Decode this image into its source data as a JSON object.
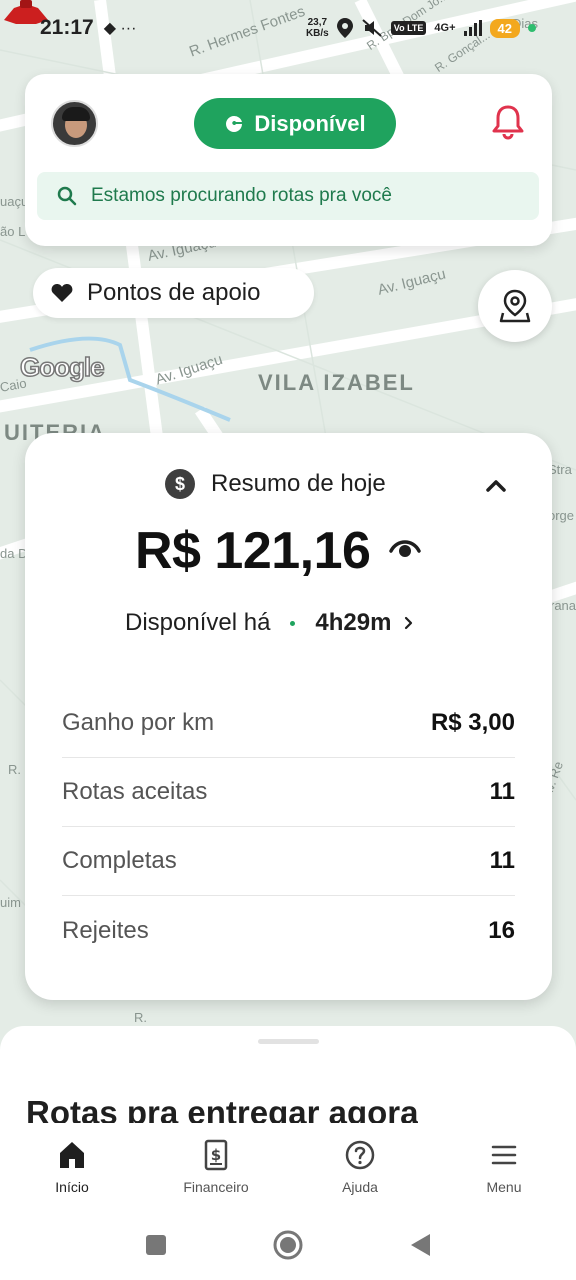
{
  "status_bar": {
    "time": "21:17",
    "left_icons": "◆ ···",
    "speed_top": "23,7",
    "speed_bottom": "KB/s",
    "network": "4G+",
    "volte": "Vo LTE",
    "battery": "42"
  },
  "map": {
    "labels": [
      "R. Hermes Fontes",
      "R. Bpo. Dom Jo...",
      "R. Gonçal...",
      "Dias",
      "Av. Iguaçu",
      "Av. Iguaçu",
      "Av. Iguaçu",
      "VILA IZABEL",
      "UITERIA",
      "Caio",
      "uaçu",
      "ão L",
      "Stra",
      "orge",
      "da D",
      "rana",
      "Av. Re",
      "R.",
      "uim",
      "R."
    ],
    "attribution": "Google"
  },
  "top_card": {
    "status_label": "Disponível",
    "search_message": "Estamos procurando rotas pra você"
  },
  "apoio": {
    "label": "Pontos de apoio"
  },
  "summary": {
    "title": "Resumo de hoje",
    "amount": "R$ 121,16",
    "available_label": "Disponível há",
    "available_time": "4h29m",
    "stats": [
      {
        "label": "Ganho por km",
        "value": "R$ 3,00"
      },
      {
        "label": "Rotas aceitas",
        "value": "11"
      },
      {
        "label": "Completas",
        "value": "11"
      },
      {
        "label": "Rejeites",
        "value": "16"
      }
    ]
  },
  "sheet": {
    "title": "Rotas pra entregar agora"
  },
  "bottom_nav": {
    "items": [
      {
        "label": "Início",
        "icon": "home-icon"
      },
      {
        "label": "Financeiro",
        "icon": "receipt-icon"
      },
      {
        "label": "Ajuda",
        "icon": "help-icon"
      },
      {
        "label": "Menu",
        "icon": "menu-icon"
      }
    ]
  },
  "colors": {
    "accent_green": "#1fa35e",
    "bell_red": "#e0334d",
    "banner_bg": "#e9f6ef"
  }
}
